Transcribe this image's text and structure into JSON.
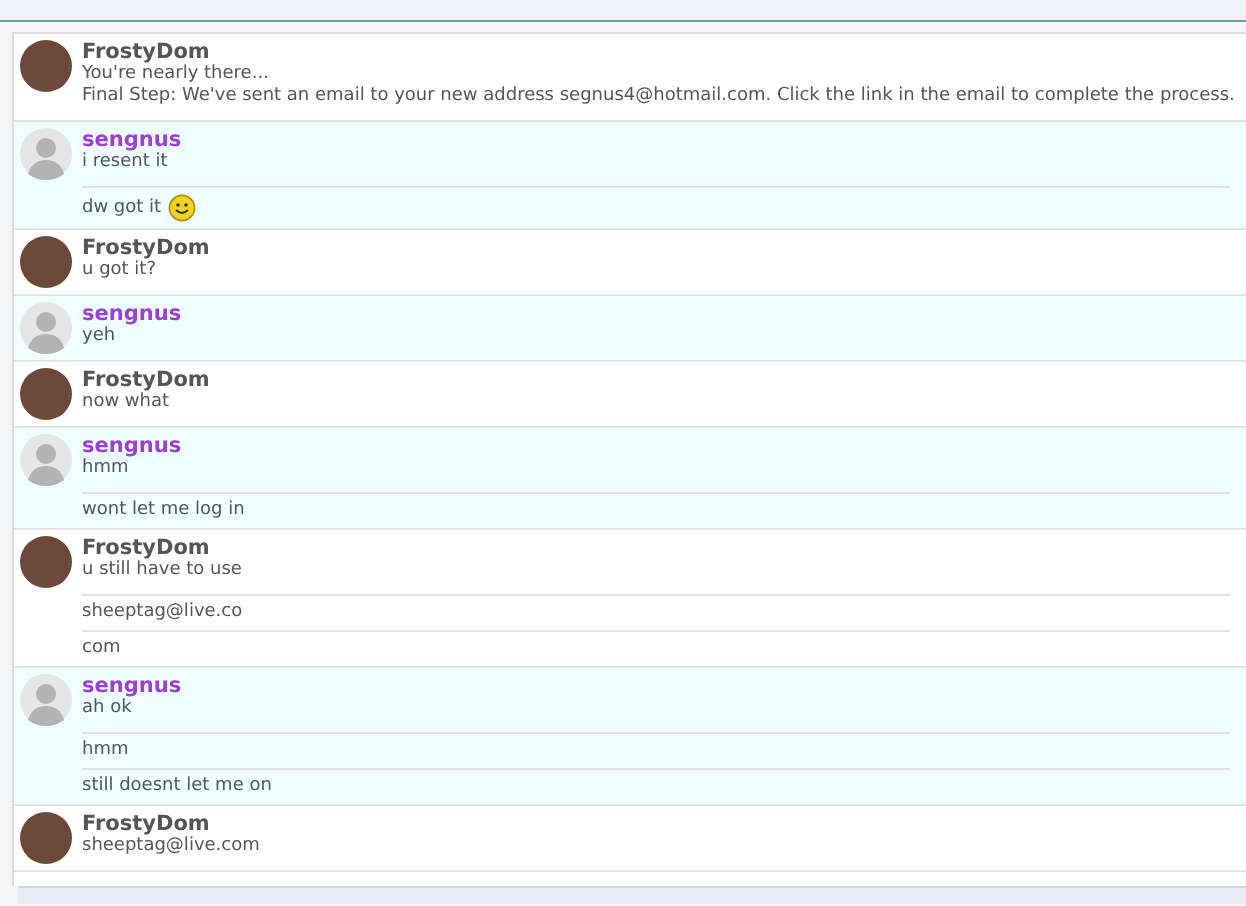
{
  "conversation": [
    {
      "sender": "FrostyDom",
      "kind": "other",
      "messages": [
        {
          "lines": [
            "You're nearly there...",
            "Final Step: We've sent an email to your new address segnus4@hotmail.com. Click the link in the email to complete the process."
          ]
        }
      ]
    },
    {
      "sender": "sengnus",
      "kind": "self",
      "messages": [
        {
          "lines": [
            "i resent it"
          ]
        },
        {
          "lines": [
            "dw got it"
          ],
          "smiley": true
        }
      ]
    },
    {
      "sender": "FrostyDom",
      "kind": "other",
      "messages": [
        {
          "lines": [
            "u got it?"
          ]
        }
      ]
    },
    {
      "sender": "sengnus",
      "kind": "self",
      "messages": [
        {
          "lines": [
            "yeh"
          ]
        }
      ]
    },
    {
      "sender": "FrostyDom",
      "kind": "other",
      "messages": [
        {
          "lines": [
            "now what"
          ]
        }
      ]
    },
    {
      "sender": "sengnus",
      "kind": "self",
      "messages": [
        {
          "lines": [
            "hmm"
          ]
        },
        {
          "lines": [
            "wont let me log in"
          ]
        }
      ]
    },
    {
      "sender": "FrostyDom",
      "kind": "other",
      "messages": [
        {
          "lines": [
            "u still have to use"
          ]
        },
        {
          "lines": [
            "sheeptag@live.co"
          ]
        },
        {
          "lines": [
            "com"
          ]
        }
      ]
    },
    {
      "sender": "sengnus",
      "kind": "self",
      "messages": [
        {
          "lines": [
            "ah ok"
          ]
        },
        {
          "lines": [
            "hmm"
          ]
        },
        {
          "lines": [
            "still doesnt let me on"
          ]
        }
      ]
    },
    {
      "sender": "FrostyDom",
      "kind": "other",
      "messages": [
        {
          "lines": [
            "sheeptag@live.com"
          ]
        }
      ]
    }
  ]
}
